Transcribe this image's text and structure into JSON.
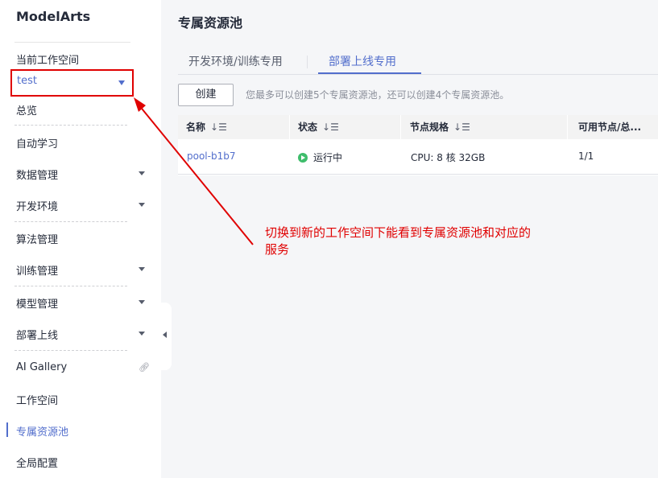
{
  "sidebar": {
    "brand": "ModelArts",
    "workspace_label": "当前工作空间",
    "workspace_value": "test",
    "items": [
      {
        "label": "总览"
      },
      {
        "label": "自动学习"
      },
      {
        "label": "数据管理"
      },
      {
        "label": "开发环境"
      },
      {
        "label": "算法管理"
      },
      {
        "label": "训练管理"
      },
      {
        "label": "模型管理"
      },
      {
        "label": "部署上线"
      },
      {
        "label": "AI Gallery"
      },
      {
        "label": "工作空间"
      },
      {
        "label": "专属资源池"
      },
      {
        "label": "全局配置"
      }
    ]
  },
  "main": {
    "title": "专属资源池",
    "tabs": [
      {
        "label": "开发环境/训练专用"
      },
      {
        "label": "部署上线专用"
      }
    ],
    "create_label": "创建",
    "hint": "您最多可以创建5个专属资源池，还可以创建4个专属资源池。",
    "table": {
      "columns": [
        "名称",
        "状态",
        "节点规格",
        "可用节点/总..."
      ],
      "sort_icon": "↓☰",
      "rows": [
        {
          "name": "pool-b1b7",
          "status": "运行中",
          "spec": "CPU: 8 核 32GB",
          "nodes": "1/1"
        }
      ]
    }
  },
  "annotation": {
    "text": "切换到新的工作空间下能看到专属资源池和对应的服务"
  },
  "colors": {
    "accent": "#526ecc",
    "highlight_red": "#e00000",
    "status_green": "#3ebd6b"
  }
}
